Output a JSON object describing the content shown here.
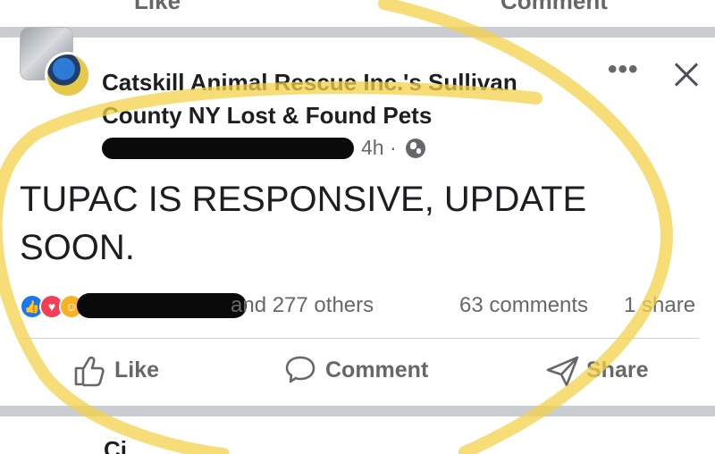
{
  "previous_post": {
    "actions": [
      "Like",
      "Comment"
    ]
  },
  "post": {
    "group_name": "Catskill Animal Rescue Inc.'s Sullivan County NY Lost & Found Pets",
    "timestamp": "4h",
    "separator": "·",
    "privacy_icon": "globe-icon",
    "menu_label": "•••",
    "body": "TUPAC IS RESPONSIVE,  UPDATE SOON.",
    "reactions": {
      "icons": [
        "like",
        "love",
        "care"
      ],
      "others_text": "and 277 others",
      "comments_text": "63 comments",
      "shares_text": "1 share"
    },
    "actions": {
      "like_label": "Like",
      "comment_label": "Comment",
      "share_label": "Share"
    }
  },
  "next_post": {
    "name_fragment": "Ci..."
  },
  "colors": {
    "reaction_like": "#1877f2",
    "reaction_love": "#f33e58",
    "reaction_care": "#f7b125",
    "secondary_text": "#65676b",
    "highlight_circle": "#f3d24a"
  }
}
